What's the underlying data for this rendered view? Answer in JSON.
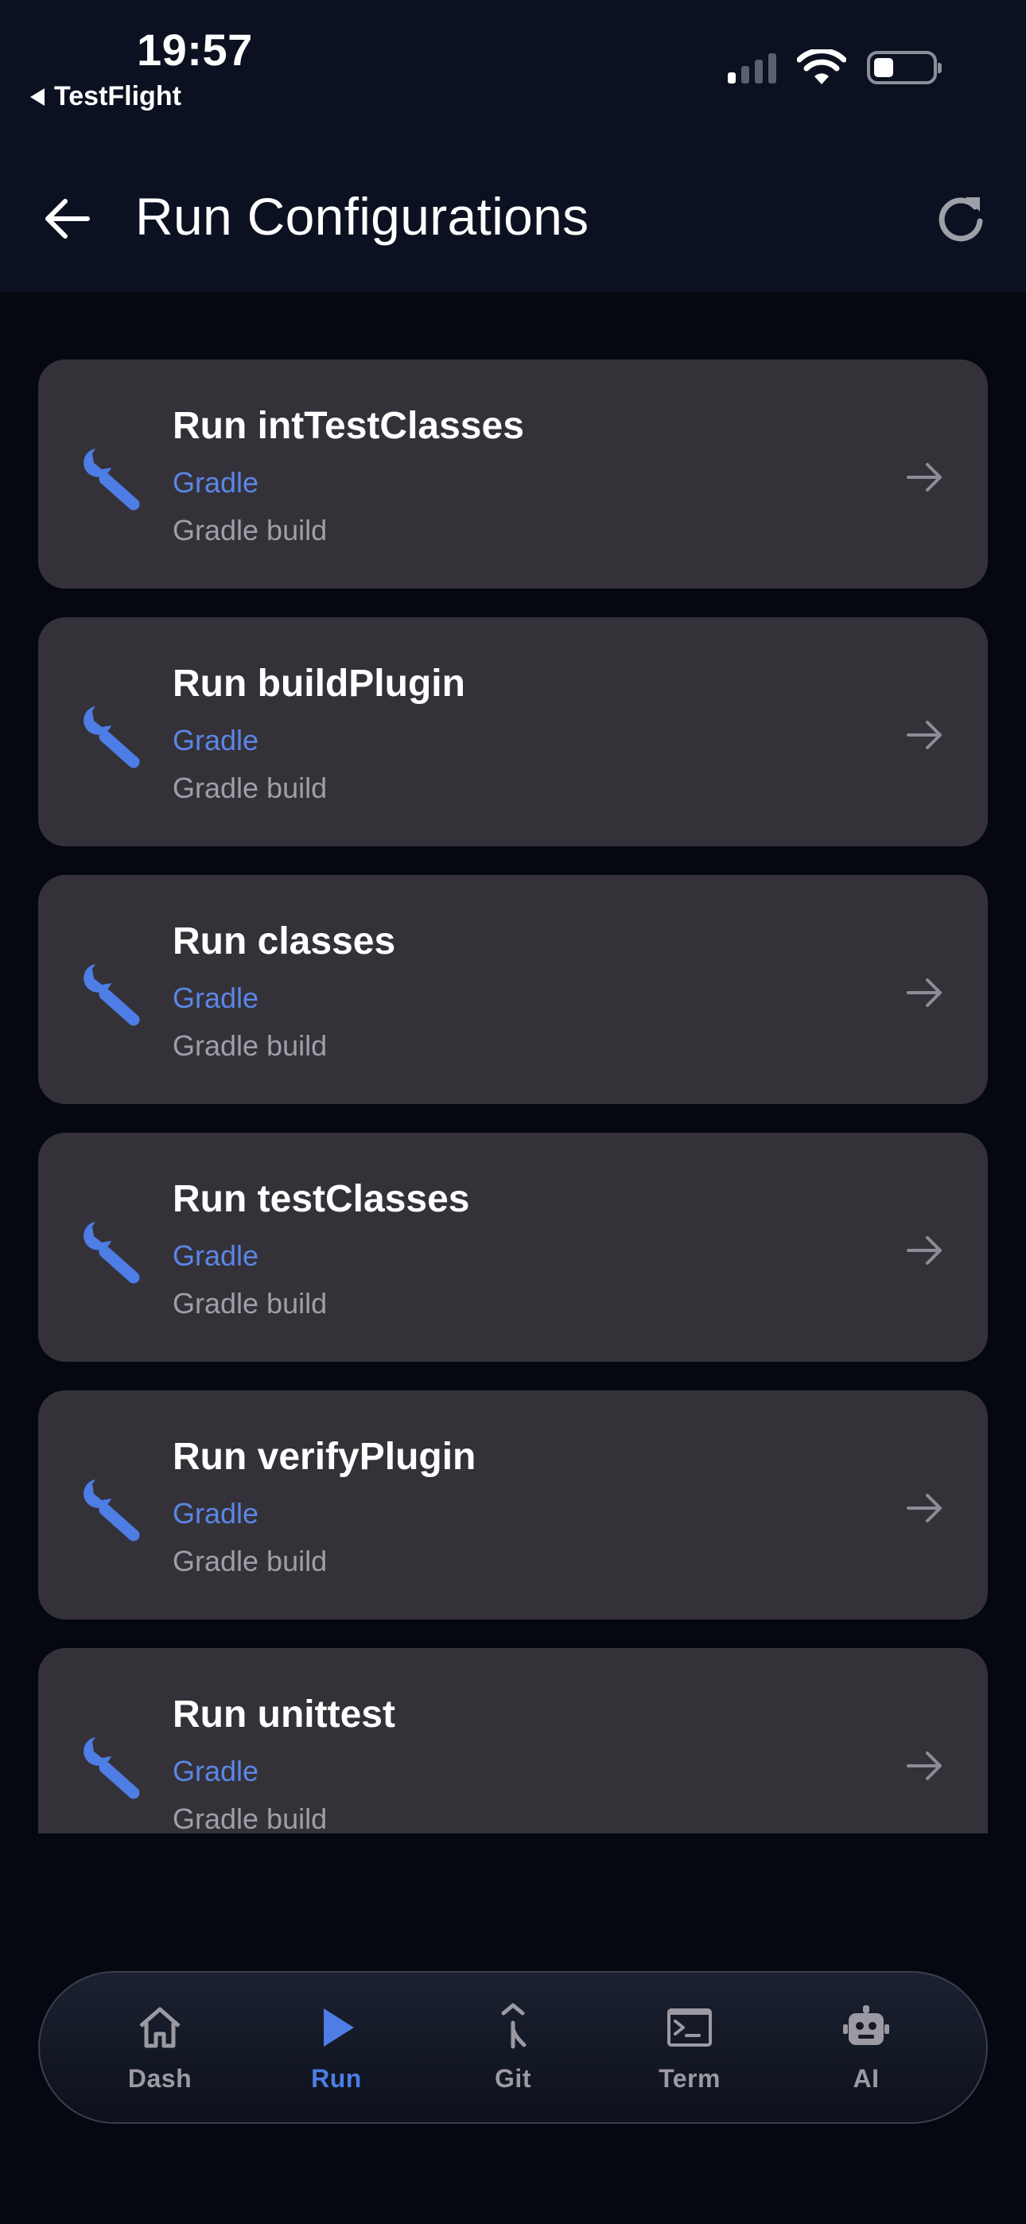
{
  "status_bar": {
    "time": "19:57",
    "back_app": "TestFlight"
  },
  "header": {
    "title": "Run Configurations",
    "back_icon": "arrow-left-icon",
    "refresh_icon": "refresh-icon"
  },
  "configs": [
    {
      "name": "Run intTestClasses",
      "type": "Gradle",
      "desc": "Gradle build"
    },
    {
      "name": "Run buildPlugin",
      "type": "Gradle",
      "desc": "Gradle build"
    },
    {
      "name": "Run classes",
      "type": "Gradle",
      "desc": "Gradle build"
    },
    {
      "name": "Run testClasses",
      "type": "Gradle",
      "desc": "Gradle build"
    },
    {
      "name": "Run verifyPlugin",
      "type": "Gradle",
      "desc": "Gradle build"
    },
    {
      "name": "Run unittest",
      "type": "Gradle",
      "desc": "Gradle build"
    }
  ],
  "nav": {
    "items": [
      {
        "label": "Dash",
        "icon": "home-icon",
        "active": false
      },
      {
        "label": "Run",
        "icon": "play-icon",
        "active": true
      },
      {
        "label": "Git",
        "icon": "git-merge-icon",
        "active": false
      },
      {
        "label": "Term",
        "icon": "terminal-icon",
        "active": false
      },
      {
        "label": "AI",
        "icon": "robot-icon",
        "active": false
      }
    ]
  },
  "colors": {
    "accent": "#4d7de5",
    "card_bg": "#343139",
    "page_bg": "#050711",
    "header_bg": "#0b1120"
  }
}
